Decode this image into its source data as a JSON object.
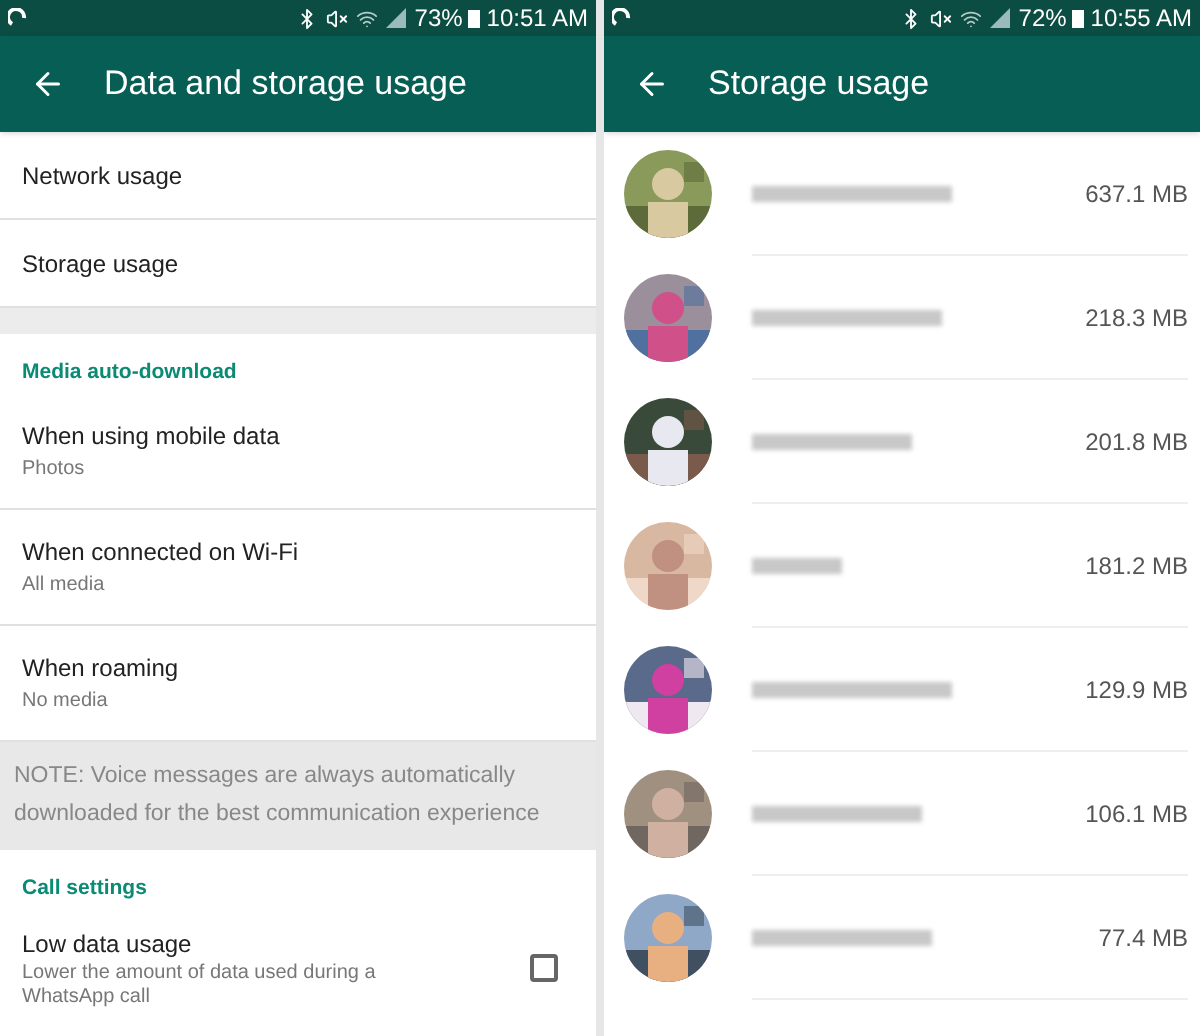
{
  "screens": [
    {
      "status_bar": {
        "battery": "73%",
        "time": "10:51 AM"
      },
      "title": "Data and storage usage",
      "sections": [
        {
          "items": [
            {
              "kind": "plain",
              "title": "Network usage"
            },
            {
              "kind": "plain",
              "title": "Storage usage"
            }
          ]
        },
        {
          "header": "Media auto-download",
          "items": [
            {
              "kind": "plain",
              "title": "When using mobile data",
              "subtitle": "Photos"
            },
            {
              "kind": "plain",
              "title": "When connected on Wi-Fi",
              "subtitle": "All media"
            },
            {
              "kind": "plain",
              "title": "When roaming",
              "subtitle": "No media"
            },
            {
              "kind": "note",
              "title": "NOTE: Voice messages are always automatically downloaded for the best communication experience"
            }
          ]
        },
        {
          "header": "Call settings",
          "items": [
            {
              "kind": "checkbox",
              "title": "Low data usage",
              "subtitle": "Lower the amount of data used during a WhatsApp call",
              "checked": false
            }
          ]
        }
      ]
    },
    {
      "status_bar": {
        "battery": "72%",
        "time": "10:55 AM"
      },
      "title": "Storage usage",
      "contacts": [
        {
          "size": "637.1 MB"
        },
        {
          "size": "218.3 MB"
        },
        {
          "size": "201.8 MB"
        },
        {
          "size": "181.2 MB"
        },
        {
          "size": "129.9 MB"
        },
        {
          "size": "106.1 MB"
        },
        {
          "size": "77.4 MB"
        }
      ]
    }
  ]
}
